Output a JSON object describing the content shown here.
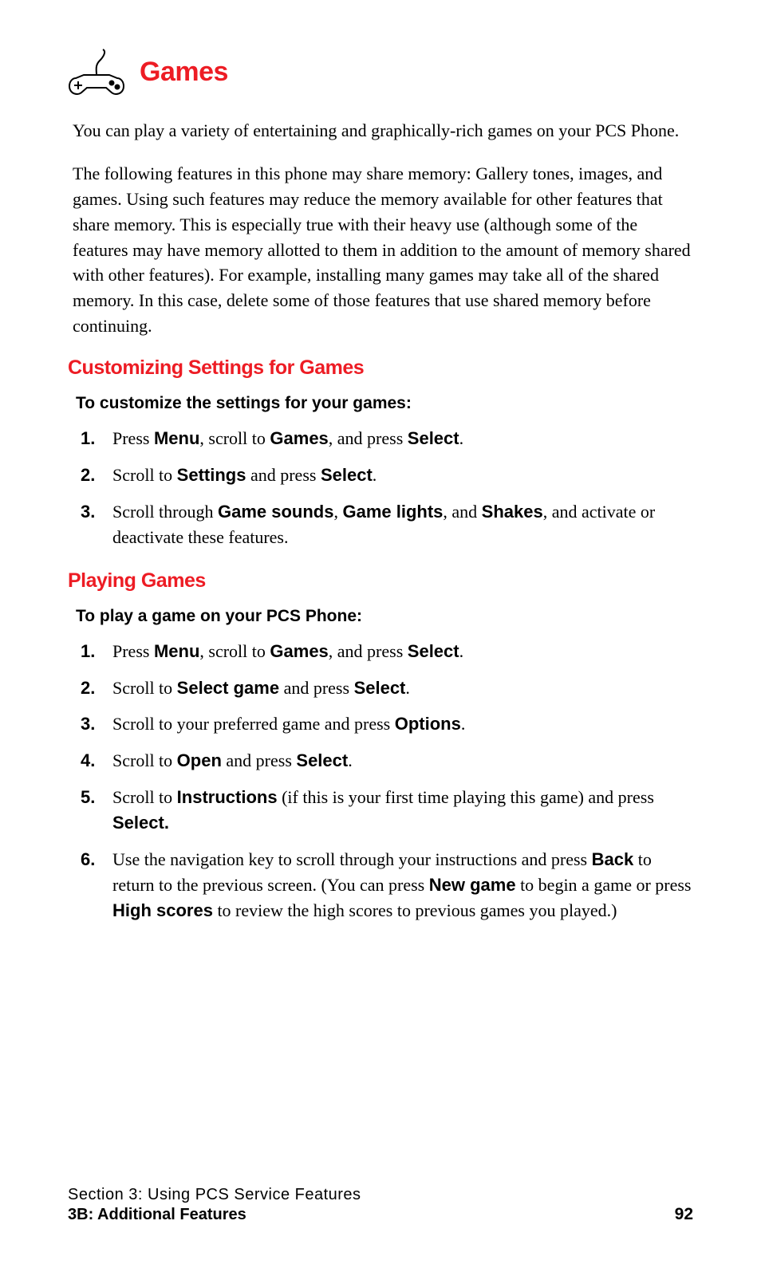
{
  "title": "Games",
  "intro1": "You can play a variety of entertaining and graphically-rich games on your PCS Phone.",
  "intro2": "The following features in this phone may share memory: Gallery tones, images, and games. Using such features may reduce the memory available for other features that share memory. This is especially true with their heavy use (although some of the features may have memory allotted to them in addition to the amount of memory shared with other features). For example, installing many games may take all of the shared memory. In this case, delete some of those features that use shared memory before continuing.",
  "section1": {
    "heading": "Customizing Settings for Games",
    "sub": "To customize the settings for your games:",
    "steps": [
      "Press <b>Menu</b>, scroll to <b>Games</b>, and press <b>Select</b>.",
      "Scroll to <b>Settings</b> and press <b>Select</b>.",
      "Scroll through <b>Game sounds</b>, <b>Game lights</b>, and <b>Shakes</b>, and activate or deactivate these features."
    ]
  },
  "section2": {
    "heading": "Playing Games",
    "sub": "To play a game on your PCS Phone:",
    "steps": [
      "Press <b>Menu</b>, scroll to <b>Games</b>, and press <b>Select</b>.",
      "Scroll to <b>Select game</b> and press <b>Select</b>.",
      "Scroll to your preferred game and press <b>Options</b>.",
      "Scroll to <b>Open</b> and press <b>Select</b>.",
      "Scroll to <b>Instructions</b> (if this is your first time playing this game) and press <b>Select.</b>",
      "Use the navigation key to scroll through your instructions and press <b>Back</b> to return to the previous screen. (You can press <b>New game</b> to begin a game or press <b>High scores</b> to review the high scores to previous games you played.)"
    ]
  },
  "footer": {
    "top": "Section 3: Using PCS Service Features",
    "bottom": "3B: Additional Features",
    "page": "92"
  }
}
